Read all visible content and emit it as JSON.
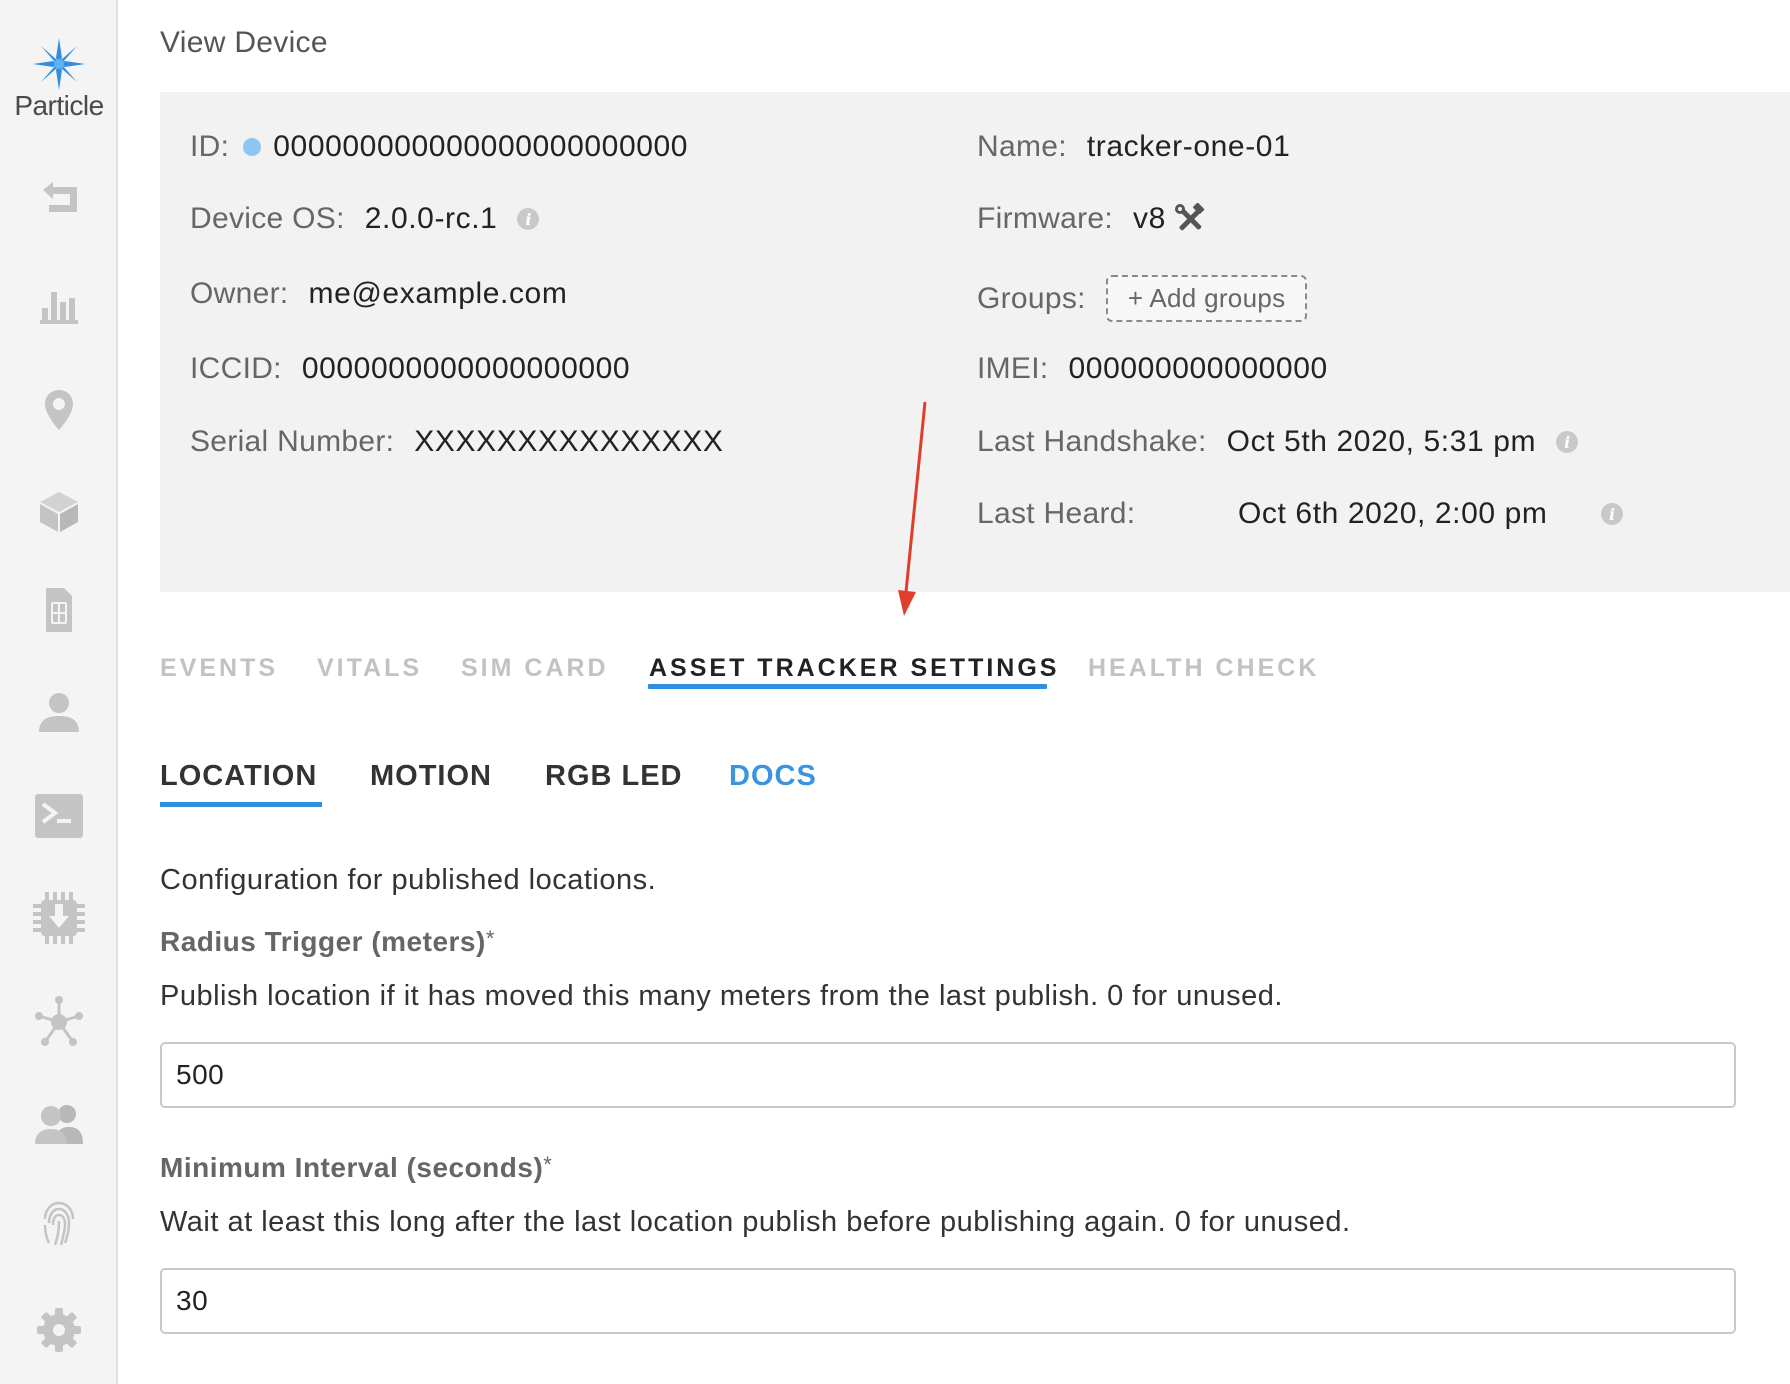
{
  "brand": {
    "name": "Particle"
  },
  "sidebar": {
    "items": [
      {
        "icon": "back-arrow-icon"
      },
      {
        "icon": "bar-chart-icon"
      },
      {
        "icon": "map-pin-icon"
      },
      {
        "icon": "cube-icon"
      },
      {
        "icon": "sim-card-icon"
      },
      {
        "icon": "user-icon"
      },
      {
        "icon": "terminal-icon"
      },
      {
        "icon": "chip-download-icon"
      },
      {
        "icon": "network-icon"
      },
      {
        "icon": "team-icon"
      },
      {
        "icon": "fingerprint-icon"
      },
      {
        "icon": "gear-icon"
      }
    ]
  },
  "page": {
    "title": "View Device"
  },
  "device": {
    "id_label": "ID:",
    "id_value": "000000000000000000000000",
    "os_label": "Device OS:",
    "os_value": "2.0.0-rc.1",
    "owner_label": "Owner:",
    "owner_value": "me@example.com",
    "iccid_label": "ICCID:",
    "iccid_value": "0000000000000000000",
    "serial_label": "Serial Number:",
    "serial_value": "XXXXXXXXXXXXXXX",
    "name_label": "Name:",
    "name_value": "tracker-one-01",
    "firmware_label": "Firmware:",
    "firmware_value": "v8",
    "groups_label": "Groups:",
    "add_groups": "+ Add groups",
    "imei_label": "IMEI:",
    "imei_value": "000000000000000",
    "handshake_label": "Last Handshake:",
    "handshake_value": "Oct 5th 2020, 5:31 pm",
    "heard_label": "Last Heard:",
    "heard_value": "Oct 6th 2020, 2:00 pm",
    "status_dot_color": "#8fc6f1"
  },
  "tabs": [
    {
      "label": "EVENTS"
    },
    {
      "label": "VITALS"
    },
    {
      "label": "SIM CARD"
    },
    {
      "label": "ASSET TRACKER SETTINGS",
      "active": true
    },
    {
      "label": "HEALTH CHECK"
    }
  ],
  "subtabs": [
    {
      "label": "LOCATION",
      "active": true
    },
    {
      "label": "MOTION"
    },
    {
      "label": "RGB LED"
    },
    {
      "label": "DOCS"
    }
  ],
  "location": {
    "intro": "Configuration for published locations.",
    "radius_label": "Radius Trigger (meters)",
    "radius_required": "*",
    "radius_help": "Publish location if it has moved this many meters from the last publish. 0 for unused.",
    "radius_value": "500",
    "interval_label": "Minimum Interval (seconds)",
    "interval_required": "*",
    "interval_help": "Wait at least this long after the last location publish before publishing again. 0 for unused.",
    "interval_value": "30"
  },
  "colors": {
    "accent": "#2f8fe0",
    "docs_link": "#3b94e0",
    "annotation_arrow": "#e03e2d"
  }
}
